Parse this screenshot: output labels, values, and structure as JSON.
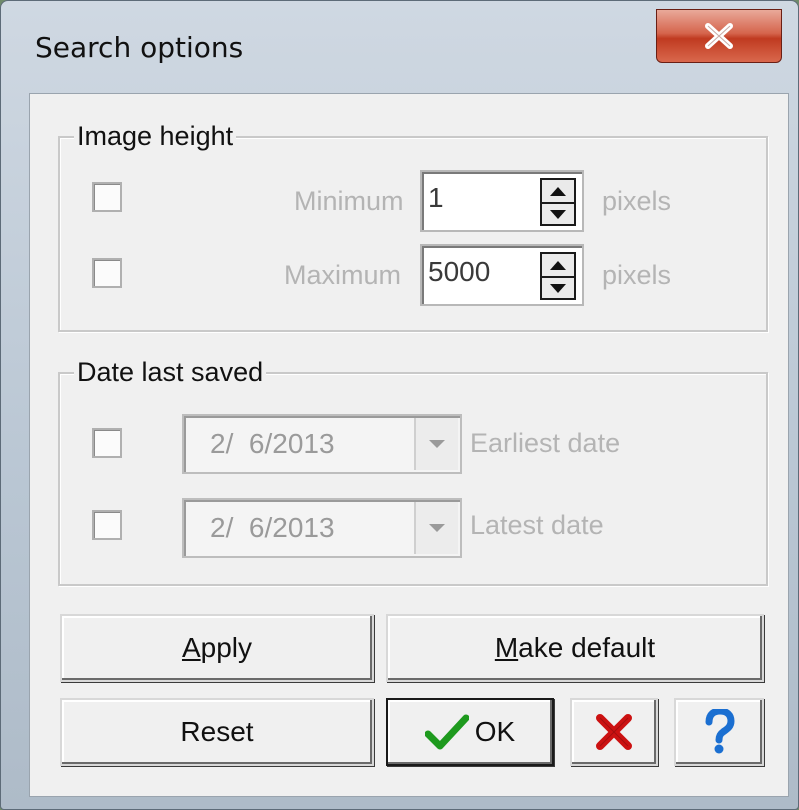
{
  "window": {
    "title": "Search options"
  },
  "image_height": {
    "group_label": "Image height",
    "minimum": {
      "label": "Minimum",
      "value": "1",
      "unit": "pixels",
      "checked": false
    },
    "maximum": {
      "label": "Maximum",
      "value": "5000",
      "unit": "pixels",
      "checked": false
    }
  },
  "date_last_saved": {
    "group_label": "Date last saved",
    "earliest": {
      "label": "Earliest date",
      "value": "2/  6/2013",
      "checked": false
    },
    "latest": {
      "label": "Latest date",
      "value": "2/  6/2013",
      "checked": false
    }
  },
  "buttons": {
    "apply": {
      "accel": "A",
      "rest": "pply"
    },
    "make_default": {
      "accel": "M",
      "rest": "ake default"
    },
    "reset": "Reset",
    "ok": "OK"
  },
  "icons": {
    "close": "close-icon",
    "check": "checkmark-icon",
    "cancel": "red-x-icon",
    "help": "question-mark-icon"
  },
  "colors": {
    "check": "#1e9a1e",
    "cancel": "#cc1111",
    "help": "#1b6fd1",
    "close_button": "#c8432a"
  }
}
